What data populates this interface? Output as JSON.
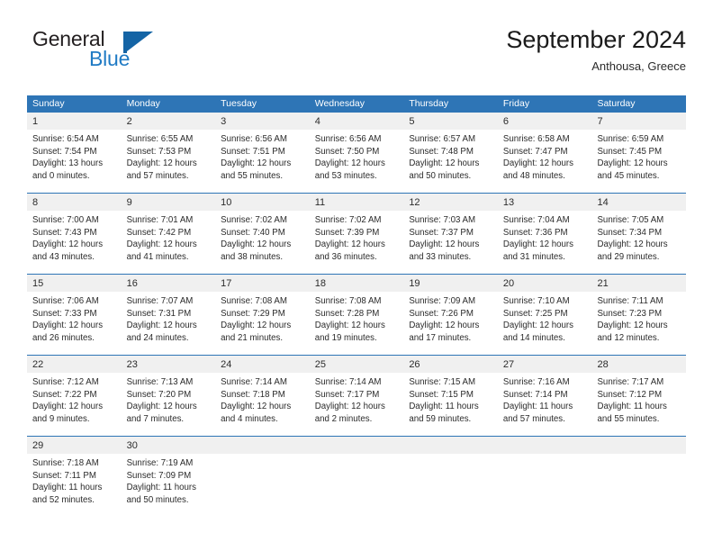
{
  "brand": {
    "name_part1": "General",
    "name_part2": "Blue",
    "flag_icon": "flag-icon",
    "accent_color": "#1464a5"
  },
  "header": {
    "title": "September 2024",
    "location": "Anthousa, Greece"
  },
  "theme": {
    "header_bg": "#2e75b6",
    "header_text": "#ffffff",
    "day_band_bg": "#f0f0f0",
    "row_divider": "#2e75b6"
  },
  "calendar": {
    "weekdays": [
      "Sunday",
      "Monday",
      "Tuesday",
      "Wednesday",
      "Thursday",
      "Friday",
      "Saturday"
    ],
    "weeks": [
      [
        {
          "day": "1",
          "lines": [
            "Sunrise: 6:54 AM",
            "Sunset: 7:54 PM",
            "Daylight: 13 hours",
            "and 0 minutes."
          ]
        },
        {
          "day": "2",
          "lines": [
            "Sunrise: 6:55 AM",
            "Sunset: 7:53 PM",
            "Daylight: 12 hours",
            "and 57 minutes."
          ]
        },
        {
          "day": "3",
          "lines": [
            "Sunrise: 6:56 AM",
            "Sunset: 7:51 PM",
            "Daylight: 12 hours",
            "and 55 minutes."
          ]
        },
        {
          "day": "4",
          "lines": [
            "Sunrise: 6:56 AM",
            "Sunset: 7:50 PM",
            "Daylight: 12 hours",
            "and 53 minutes."
          ]
        },
        {
          "day": "5",
          "lines": [
            "Sunrise: 6:57 AM",
            "Sunset: 7:48 PM",
            "Daylight: 12 hours",
            "and 50 minutes."
          ]
        },
        {
          "day": "6",
          "lines": [
            "Sunrise: 6:58 AM",
            "Sunset: 7:47 PM",
            "Daylight: 12 hours",
            "and 48 minutes."
          ]
        },
        {
          "day": "7",
          "lines": [
            "Sunrise: 6:59 AM",
            "Sunset: 7:45 PM",
            "Daylight: 12 hours",
            "and 45 minutes."
          ]
        }
      ],
      [
        {
          "day": "8",
          "lines": [
            "Sunrise: 7:00 AM",
            "Sunset: 7:43 PM",
            "Daylight: 12 hours",
            "and 43 minutes."
          ]
        },
        {
          "day": "9",
          "lines": [
            "Sunrise: 7:01 AM",
            "Sunset: 7:42 PM",
            "Daylight: 12 hours",
            "and 41 minutes."
          ]
        },
        {
          "day": "10",
          "lines": [
            "Sunrise: 7:02 AM",
            "Sunset: 7:40 PM",
            "Daylight: 12 hours",
            "and 38 minutes."
          ]
        },
        {
          "day": "11",
          "lines": [
            "Sunrise: 7:02 AM",
            "Sunset: 7:39 PM",
            "Daylight: 12 hours",
            "and 36 minutes."
          ]
        },
        {
          "day": "12",
          "lines": [
            "Sunrise: 7:03 AM",
            "Sunset: 7:37 PM",
            "Daylight: 12 hours",
            "and 33 minutes."
          ]
        },
        {
          "day": "13",
          "lines": [
            "Sunrise: 7:04 AM",
            "Sunset: 7:36 PM",
            "Daylight: 12 hours",
            "and 31 minutes."
          ]
        },
        {
          "day": "14",
          "lines": [
            "Sunrise: 7:05 AM",
            "Sunset: 7:34 PM",
            "Daylight: 12 hours",
            "and 29 minutes."
          ]
        }
      ],
      [
        {
          "day": "15",
          "lines": [
            "Sunrise: 7:06 AM",
            "Sunset: 7:33 PM",
            "Daylight: 12 hours",
            "and 26 minutes."
          ]
        },
        {
          "day": "16",
          "lines": [
            "Sunrise: 7:07 AM",
            "Sunset: 7:31 PM",
            "Daylight: 12 hours",
            "and 24 minutes."
          ]
        },
        {
          "day": "17",
          "lines": [
            "Sunrise: 7:08 AM",
            "Sunset: 7:29 PM",
            "Daylight: 12 hours",
            "and 21 minutes."
          ]
        },
        {
          "day": "18",
          "lines": [
            "Sunrise: 7:08 AM",
            "Sunset: 7:28 PM",
            "Daylight: 12 hours",
            "and 19 minutes."
          ]
        },
        {
          "day": "19",
          "lines": [
            "Sunrise: 7:09 AM",
            "Sunset: 7:26 PM",
            "Daylight: 12 hours",
            "and 17 minutes."
          ]
        },
        {
          "day": "20",
          "lines": [
            "Sunrise: 7:10 AM",
            "Sunset: 7:25 PM",
            "Daylight: 12 hours",
            "and 14 minutes."
          ]
        },
        {
          "day": "21",
          "lines": [
            "Sunrise: 7:11 AM",
            "Sunset: 7:23 PM",
            "Daylight: 12 hours",
            "and 12 minutes."
          ]
        }
      ],
      [
        {
          "day": "22",
          "lines": [
            "Sunrise: 7:12 AM",
            "Sunset: 7:22 PM",
            "Daylight: 12 hours",
            "and 9 minutes."
          ]
        },
        {
          "day": "23",
          "lines": [
            "Sunrise: 7:13 AM",
            "Sunset: 7:20 PM",
            "Daylight: 12 hours",
            "and 7 minutes."
          ]
        },
        {
          "day": "24",
          "lines": [
            "Sunrise: 7:14 AM",
            "Sunset: 7:18 PM",
            "Daylight: 12 hours",
            "and 4 minutes."
          ]
        },
        {
          "day": "25",
          "lines": [
            "Sunrise: 7:14 AM",
            "Sunset: 7:17 PM",
            "Daylight: 12 hours",
            "and 2 minutes."
          ]
        },
        {
          "day": "26",
          "lines": [
            "Sunrise: 7:15 AM",
            "Sunset: 7:15 PM",
            "Daylight: 11 hours",
            "and 59 minutes."
          ]
        },
        {
          "day": "27",
          "lines": [
            "Sunrise: 7:16 AM",
            "Sunset: 7:14 PM",
            "Daylight: 11 hours",
            "and 57 minutes."
          ]
        },
        {
          "day": "28",
          "lines": [
            "Sunrise: 7:17 AM",
            "Sunset: 7:12 PM",
            "Daylight: 11 hours",
            "and 55 minutes."
          ]
        }
      ],
      [
        {
          "day": "29",
          "lines": [
            "Sunrise: 7:18 AM",
            "Sunset: 7:11 PM",
            "Daylight: 11 hours",
            "and 52 minutes."
          ]
        },
        {
          "day": "30",
          "lines": [
            "Sunrise: 7:19 AM",
            "Sunset: 7:09 PM",
            "Daylight: 11 hours",
            "and 50 minutes."
          ]
        },
        {
          "day": "",
          "lines": []
        },
        {
          "day": "",
          "lines": []
        },
        {
          "day": "",
          "lines": []
        },
        {
          "day": "",
          "lines": []
        },
        {
          "day": "",
          "lines": []
        }
      ]
    ]
  }
}
